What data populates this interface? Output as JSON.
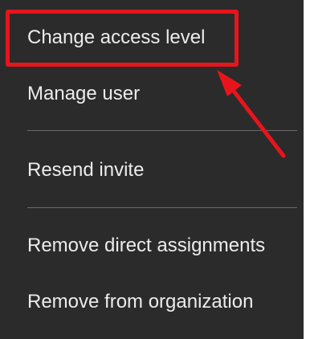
{
  "menu": {
    "items": [
      {
        "label": "Change access level"
      },
      {
        "label": "Manage user"
      },
      {
        "label": "Resend invite"
      },
      {
        "label": "Remove direct assignments"
      },
      {
        "label": "Remove from organization"
      }
    ]
  },
  "colors": {
    "menu_background": "#2b2b2b",
    "menu_text": "#ececec",
    "divider": "#6a6a6a",
    "annotation_red": "#e8141c"
  },
  "annotation": {
    "highlighted_item": "Change access level",
    "marker": "red-arrow-icon"
  }
}
